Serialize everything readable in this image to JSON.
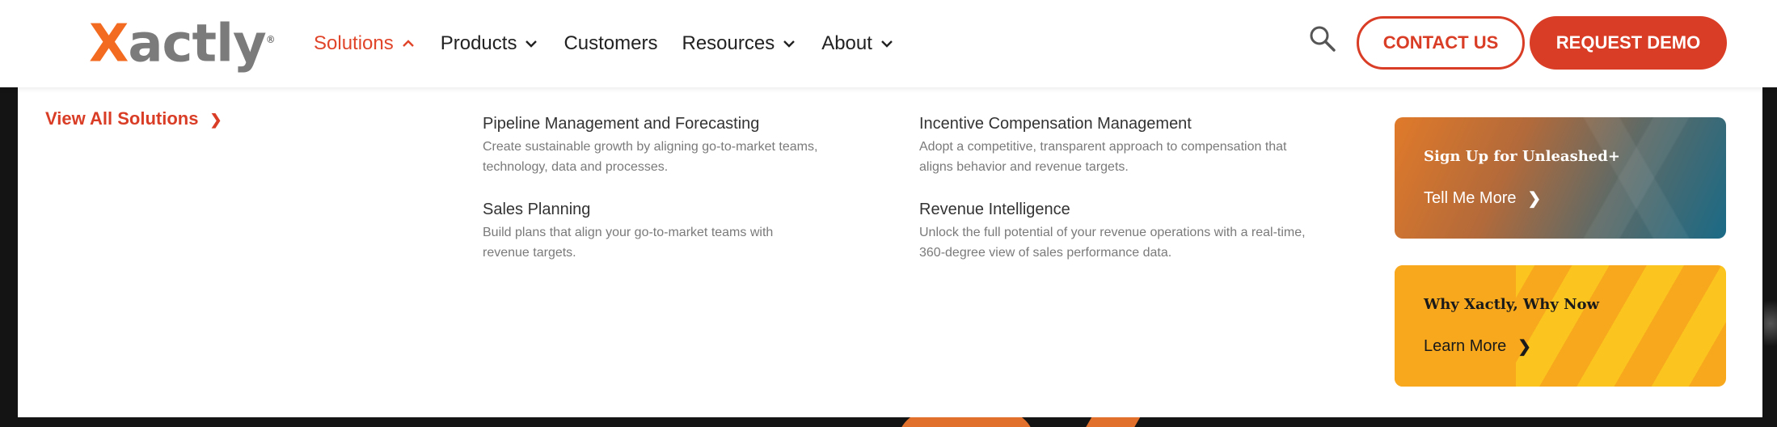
{
  "brand": {
    "logo_x": "X",
    "logo_rest": "actly",
    "logo_reg": "®",
    "accent_color": "#d93d26",
    "logo_orange": "#f26b21",
    "logo_gray": "#7b7b7b"
  },
  "nav": {
    "items": [
      {
        "label": "Solutions",
        "active": true,
        "icon": "chevron-up-icon"
      },
      {
        "label": "Products",
        "active": false,
        "icon": "chevron-down-icon"
      },
      {
        "label": "Customers",
        "active": false,
        "icon": null
      },
      {
        "label": "Resources",
        "active": false,
        "icon": "chevron-down-icon"
      },
      {
        "label": "About",
        "active": false,
        "icon": "chevron-down-icon"
      }
    ]
  },
  "header": {
    "search_icon": "search-icon",
    "contact_label": "CONTACT US",
    "demo_label": "REQUEST DEMO"
  },
  "mega": {
    "view_all_label": "View All Solutions",
    "view_all_arrow": "❯",
    "solutions": [
      {
        "title": "Pipeline Management and Forecasting",
        "desc": "Create sustainable growth by aligning go-to-market teams, technology, data and processes."
      },
      {
        "title": "Incentive Compensation Management",
        "desc": "Adopt a competitive, transparent approach to compensation that aligns behavior and revenue targets."
      },
      {
        "title": "Sales Planning",
        "desc": "Build plans that align your go-to-market teams with revenue targets."
      },
      {
        "title": "Revenue Intelligence",
        "desc": "Unlock the full potential of your revenue operations with a real-time, 360-degree view of sales performance data."
      }
    ],
    "cards": [
      {
        "title": "Sign Up for Unleashed+",
        "link": "Tell Me More",
        "arrow": "❯"
      },
      {
        "title": "Why Xactly, Why Now",
        "link": "Learn More",
        "arrow": "❯"
      }
    ]
  }
}
